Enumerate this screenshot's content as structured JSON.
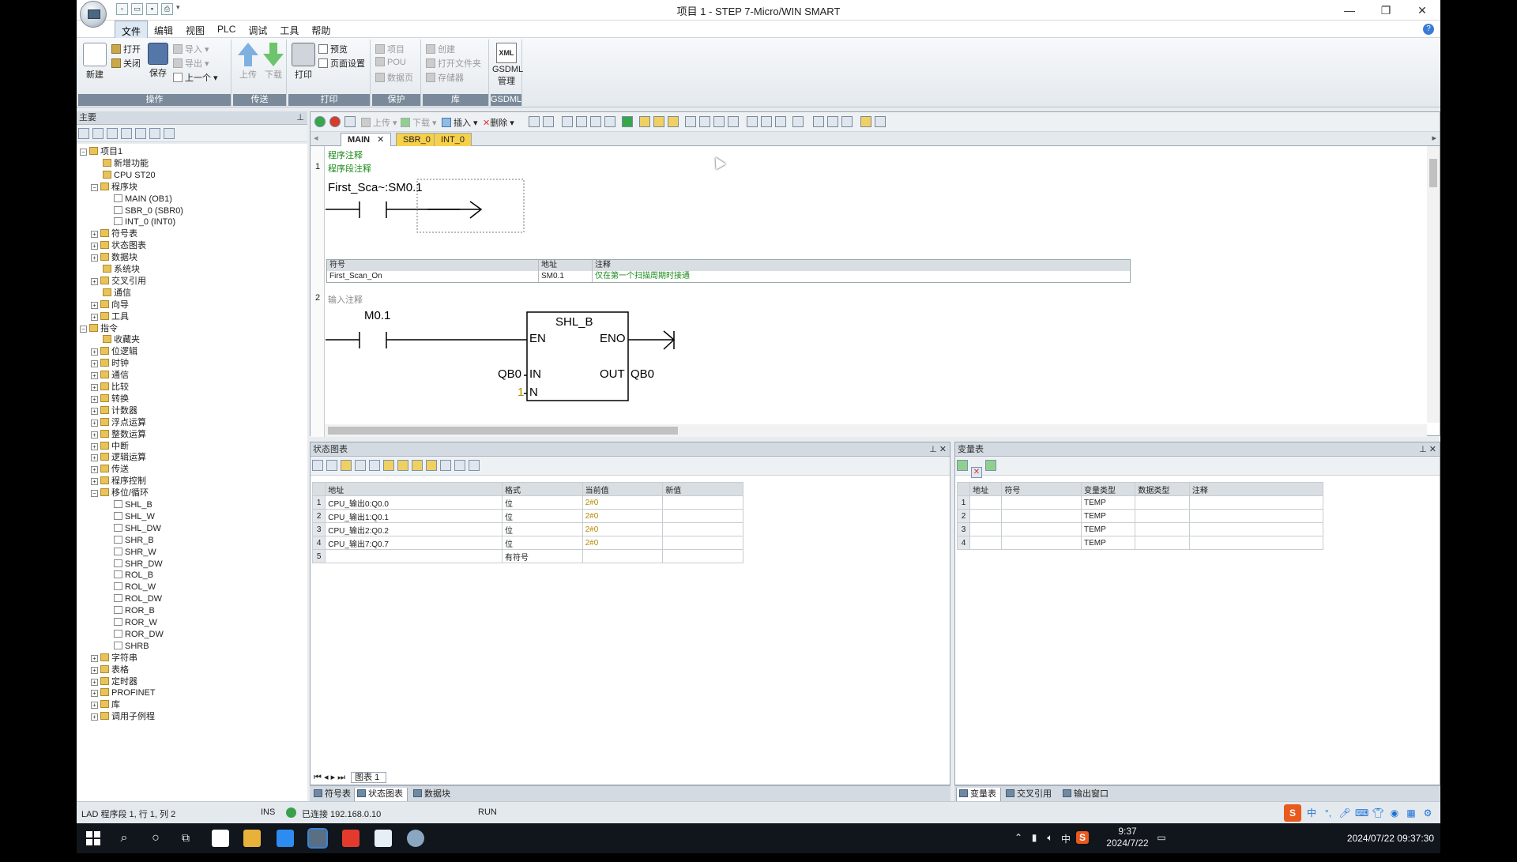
{
  "window": {
    "title": "项目 1 - STEP 7-Micro/WIN SMART",
    "min": "—",
    "restore": "❐",
    "close": "✕"
  },
  "menu": [
    "文件",
    "编辑",
    "视图",
    "PLC",
    "调试",
    "工具",
    "帮助"
  ],
  "ribbon": {
    "groups": [
      {
        "title": "操作"
      },
      {
        "title": "传送"
      },
      {
        "title": "打印"
      },
      {
        "title": "保护"
      },
      {
        "title": "库"
      },
      {
        "title": "GSDML"
      }
    ],
    "new": "新建",
    "open": "打开",
    "close": "关闭",
    "save": "保存",
    "import": "导入",
    "export": "导出",
    "prev": "上一个",
    "upload": "上传",
    "download": "下载",
    "print": "打印",
    "preview": "预览",
    "page_setup": "页面设置",
    "project": "项目",
    "pou": "POU",
    "data_page": "数据页",
    "create": "创建",
    "open_folder": "打开文件夹",
    "memory": "存储器",
    "xml": "XML",
    "gsdml": "GSDML",
    "manage": "管理"
  },
  "left_panel": {
    "title": "主要",
    "tree": [
      {
        "label": "项目1",
        "level": 0,
        "exp": "−"
      },
      {
        "label": "新增功能",
        "level": 1,
        "exp": ""
      },
      {
        "label": "CPU ST20",
        "level": 1,
        "exp": ""
      },
      {
        "label": "程序块",
        "level": 1,
        "exp": "−"
      },
      {
        "label": "MAIN (OB1)",
        "level": 2,
        "exp": ""
      },
      {
        "label": "SBR_0 (SBR0)",
        "level": 2,
        "exp": ""
      },
      {
        "label": "INT_0 (INT0)",
        "level": 2,
        "exp": ""
      },
      {
        "label": "符号表",
        "level": 1,
        "exp": "+"
      },
      {
        "label": "状态图表",
        "level": 1,
        "exp": "+"
      },
      {
        "label": "数据块",
        "level": 1,
        "exp": "+"
      },
      {
        "label": "系统块",
        "level": 1,
        "exp": ""
      },
      {
        "label": "交叉引用",
        "level": 1,
        "exp": "+"
      },
      {
        "label": "通信",
        "level": 1,
        "exp": ""
      },
      {
        "label": "向导",
        "level": 1,
        "exp": "+"
      },
      {
        "label": "工具",
        "level": 1,
        "exp": "+"
      },
      {
        "label": "指令",
        "level": 0,
        "exp": "−"
      },
      {
        "label": "收藏夹",
        "level": 1,
        "exp": ""
      },
      {
        "label": "位逻辑",
        "level": 1,
        "exp": "+"
      },
      {
        "label": "时钟",
        "level": 1,
        "exp": "+"
      },
      {
        "label": "通信",
        "level": 1,
        "exp": "+"
      },
      {
        "label": "比较",
        "level": 1,
        "exp": "+"
      },
      {
        "label": "转换",
        "level": 1,
        "exp": "+"
      },
      {
        "label": "计数器",
        "level": 1,
        "exp": "+"
      },
      {
        "label": "浮点运算",
        "level": 1,
        "exp": "+"
      },
      {
        "label": "整数运算",
        "level": 1,
        "exp": "+"
      },
      {
        "label": "中断",
        "level": 1,
        "exp": "+"
      },
      {
        "label": "逻辑运算",
        "level": 1,
        "exp": "+"
      },
      {
        "label": "传送",
        "level": 1,
        "exp": "+"
      },
      {
        "label": "程序控制",
        "level": 1,
        "exp": "+"
      },
      {
        "label": "移位/循环",
        "level": 1,
        "exp": "−"
      },
      {
        "label": "SHL_B",
        "level": 2,
        "exp": ""
      },
      {
        "label": "SHL_W",
        "level": 2,
        "exp": ""
      },
      {
        "label": "SHL_DW",
        "level": 2,
        "exp": ""
      },
      {
        "label": "SHR_B",
        "level": 2,
        "exp": ""
      },
      {
        "label": "SHR_W",
        "level": 2,
        "exp": ""
      },
      {
        "label": "SHR_DW",
        "level": 2,
        "exp": ""
      },
      {
        "label": "ROL_B",
        "level": 2,
        "exp": ""
      },
      {
        "label": "ROL_W",
        "level": 2,
        "exp": ""
      },
      {
        "label": "ROL_DW",
        "level": 2,
        "exp": ""
      },
      {
        "label": "ROR_B",
        "level": 2,
        "exp": ""
      },
      {
        "label": "ROR_W",
        "level": 2,
        "exp": ""
      },
      {
        "label": "ROR_DW",
        "level": 2,
        "exp": ""
      },
      {
        "label": "SHRB",
        "level": 2,
        "exp": ""
      },
      {
        "label": "字符串",
        "level": 1,
        "exp": "+"
      },
      {
        "label": "表格",
        "level": 1,
        "exp": "+"
      },
      {
        "label": "定时器",
        "level": 1,
        "exp": "+"
      },
      {
        "label": "PROFINET",
        "level": 1,
        "exp": "+"
      },
      {
        "label": "库",
        "level": 1,
        "exp": "+"
      },
      {
        "label": "调用子例程",
        "level": 1,
        "exp": "+"
      }
    ]
  },
  "editor": {
    "toolbar": {
      "upload": "上传",
      "download": "下载",
      "insert": "插入",
      "delete": "删除"
    },
    "tabs": [
      "MAIN",
      "SBR_0",
      "INT_0"
    ],
    "program_comment": "程序注释",
    "rung1": {
      "num": "1",
      "comment": "程序段注释",
      "contact": "First_Sca~:SM0.1",
      "sym_headers": [
        "符号",
        "地址",
        "注释"
      ],
      "sym_row": [
        "First_Scan_On",
        "SM0.1",
        "仅在第一个扫描周期时接通"
      ]
    },
    "rung2": {
      "num": "2",
      "comment": "输入注释",
      "contact": "M0.1",
      "box": "SHL_B",
      "en": "EN",
      "eno": "ENO",
      "in": "IN",
      "out": "OUT",
      "n": "N",
      "in_val": "QB0",
      "out_val": "QB0",
      "n_val": "1"
    }
  },
  "status_chart": {
    "title": "状态图表",
    "headers": [
      "地址",
      "格式",
      "当前值",
      "新值"
    ],
    "rows": [
      {
        "n": "1",
        "addr": "CPU_输出0:Q0.0",
        "fmt": "位",
        "cur": "2#0",
        "new": ""
      },
      {
        "n": "2",
        "addr": "CPU_输出1:Q0.1",
        "fmt": "位",
        "cur": "2#0",
        "new": ""
      },
      {
        "n": "3",
        "addr": "CPU_输出2:Q0.2",
        "fmt": "位",
        "cur": "2#0",
        "new": ""
      },
      {
        "n": "4",
        "addr": "CPU_输出7:Q0.7",
        "fmt": "位",
        "cur": "2#0",
        "new": ""
      },
      {
        "n": "5",
        "addr": "",
        "fmt": "有符号",
        "cur": "",
        "new": ""
      }
    ],
    "sheet_tab": "图表 1",
    "bottom_tabs": [
      "符号表",
      "状态图表",
      "数据块"
    ]
  },
  "var_table": {
    "title": "变量表",
    "headers": [
      "地址",
      "符号",
      "变量类型",
      "数据类型",
      "注释"
    ],
    "rows": [
      {
        "n": "1",
        "type": "TEMP"
      },
      {
        "n": "2",
        "type": "TEMP"
      },
      {
        "n": "3",
        "type": "TEMP"
      },
      {
        "n": "4",
        "type": "TEMP"
      }
    ],
    "bottom_tabs": [
      "变量表",
      "交叉引用",
      "输出窗口"
    ]
  },
  "statusbar": {
    "position": "LAD 程序段 1, 行 1, 列 2",
    "mode": "INS",
    "connection": "已连接 192.168.0.10",
    "run": "RUN"
  },
  "taskbar": {
    "time": "9:37",
    "date": "2024/7/22",
    "ime": "中",
    "overlay": "2024/07/22 09:37:30"
  },
  "colors": {
    "accent": "#3a7bd5",
    "green": "#3aa14a",
    "tab_yellow": "#f7d04a",
    "comment_green": "#1a8a1a"
  }
}
